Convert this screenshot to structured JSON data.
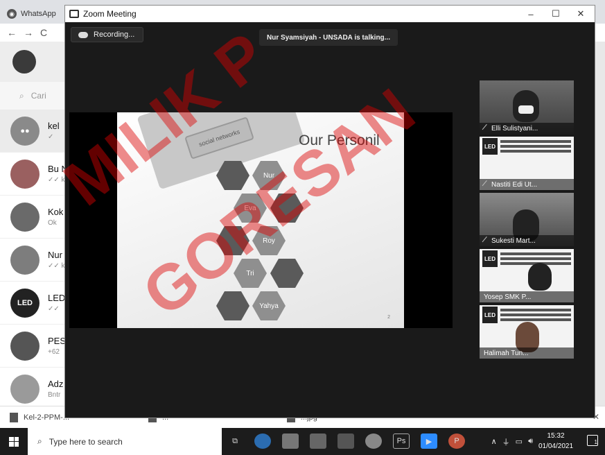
{
  "browser": {
    "tab_label": "WhatsApp",
    "search_placeholder": "Cari",
    "chats": [
      {
        "name": "kel",
        "sub": "✓"
      },
      {
        "name": "Bu N",
        "sub": "✓✓ k"
      },
      {
        "name": "Kok",
        "sub": "Ok"
      },
      {
        "name": "Nur",
        "sub": "✓✓ k"
      },
      {
        "name": "LED",
        "sub": "✓✓"
      },
      {
        "name": "PES",
        "sub": "+62"
      },
      {
        "name": "Adz",
        "sub": "Bntr"
      }
    ],
    "downloads": [
      "Kel-2-PPM-...",
      "...",
      "...jpg"
    ]
  },
  "zoom": {
    "window_title": "Zoom Meeting",
    "recording_label": "Recording...",
    "talking_label": "Nur Syamsiyah - UNSADA is talking...",
    "controls": {
      "minimize": "–",
      "maximize": "☐",
      "close": "✕"
    },
    "slide": {
      "title": "Our Personil",
      "key_text": "social networks",
      "page_number": "2",
      "members": [
        "Nur",
        "Eva",
        "Roy",
        "Tri",
        "Yahya"
      ]
    },
    "participants": [
      {
        "name": "Elli Sulistyani...",
        "kind": "camera"
      },
      {
        "name": "Nastiti Edi Ut...",
        "kind": "slide"
      },
      {
        "name": "Sukesti Mart...",
        "kind": "camera"
      },
      {
        "name": "Yosep SMK P...",
        "kind": "slide"
      },
      {
        "name": "Halimah Tun...",
        "kind": "slide"
      }
    ]
  },
  "taskbar": {
    "search_placeholder": "Type here to search",
    "time": "15:32",
    "date": "01/04/2021"
  },
  "watermark": [
    "MILIK P",
    "GORESAN"
  ]
}
